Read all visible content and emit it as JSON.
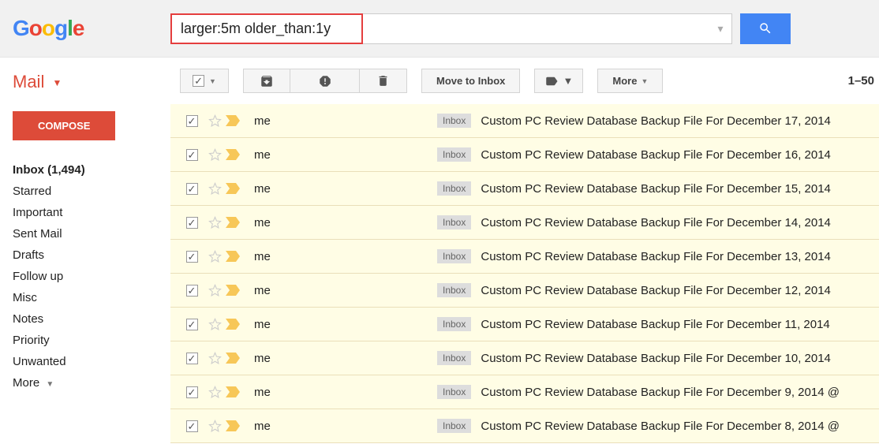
{
  "header": {
    "search_value": "larger:5m older_than:1y"
  },
  "sidebar": {
    "mail_label": "Mail",
    "compose": "COMPOSE",
    "items": [
      {
        "label": "Inbox (1,494)",
        "bold": true
      },
      {
        "label": "Starred"
      },
      {
        "label": "Important"
      },
      {
        "label": "Sent Mail"
      },
      {
        "label": "Drafts"
      },
      {
        "label": "Follow up"
      },
      {
        "label": "Misc"
      },
      {
        "label": "Notes"
      },
      {
        "label": "Priority"
      },
      {
        "label": "Unwanted"
      }
    ],
    "more": "More"
  },
  "toolbar": {
    "move": "Move to Inbox",
    "more": "More",
    "count": "1–50"
  },
  "list": {
    "inbox_label": "Inbox",
    "rows": [
      {
        "sender": "me",
        "subject": "Custom PC Review Database Backup File For December 17, 2014"
      },
      {
        "sender": "me",
        "subject": "Custom PC Review Database Backup File For December 16, 2014"
      },
      {
        "sender": "me",
        "subject": "Custom PC Review Database Backup File For December 15, 2014"
      },
      {
        "sender": "me",
        "subject": "Custom PC Review Database Backup File For December 14, 2014"
      },
      {
        "sender": "me",
        "subject": "Custom PC Review Database Backup File For December 13, 2014"
      },
      {
        "sender": "me",
        "subject": "Custom PC Review Database Backup File For December 12, 2014"
      },
      {
        "sender": "me",
        "subject": "Custom PC Review Database Backup File For December 11, 2014"
      },
      {
        "sender": "me",
        "subject": "Custom PC Review Database Backup File For December 10, 2014"
      },
      {
        "sender": "me",
        "subject": "Custom PC Review Database Backup File For December 9, 2014 @"
      },
      {
        "sender": "me",
        "subject": "Custom PC Review Database Backup File For December 8, 2014 @"
      }
    ]
  }
}
